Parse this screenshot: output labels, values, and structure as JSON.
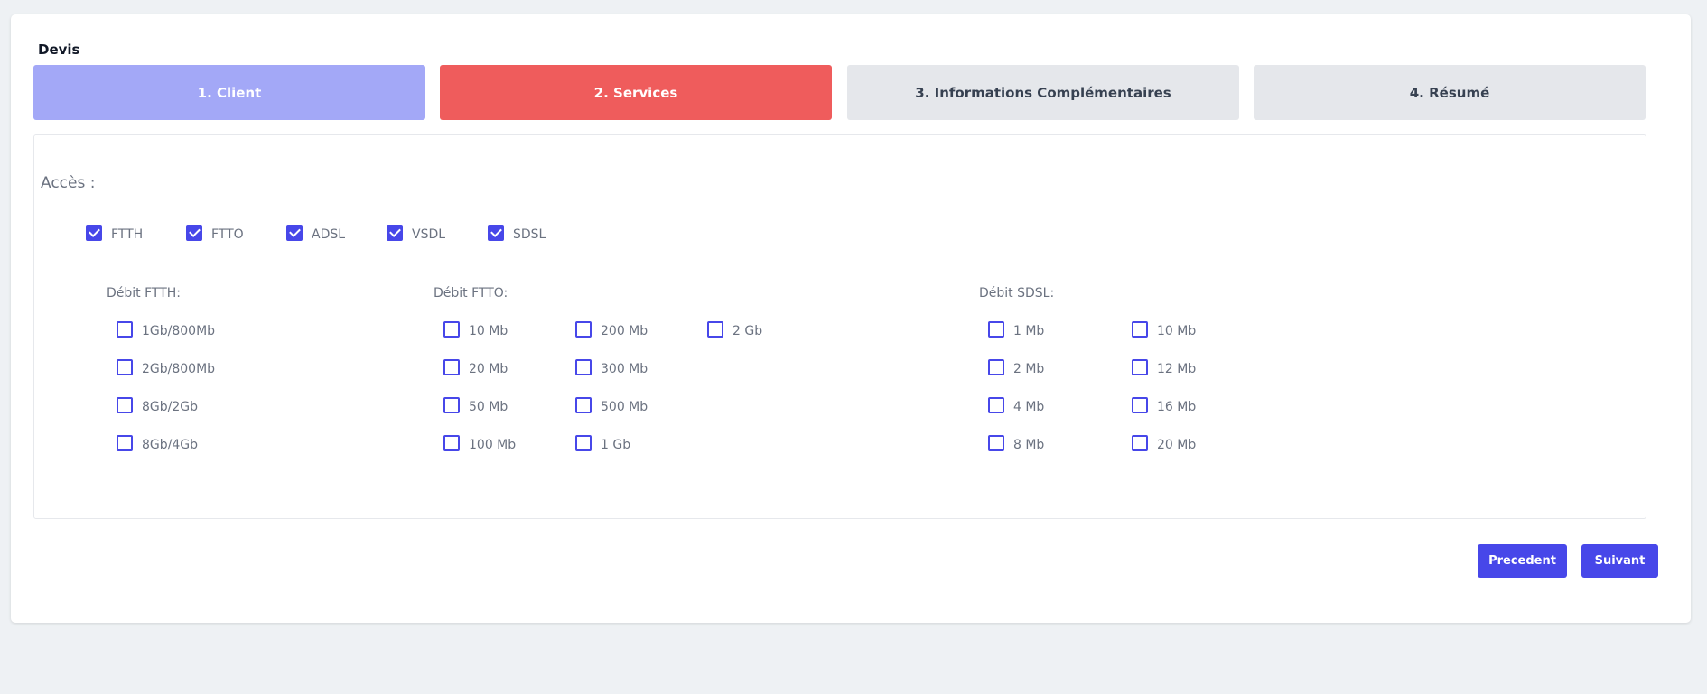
{
  "card": {
    "title": "Devis"
  },
  "steps": [
    {
      "label": "1. Client",
      "bg": "#a3a8f7",
      "fg": "#ffffff"
    },
    {
      "label": "2. Services",
      "bg": "#ef5c5c",
      "fg": "#ffffff"
    },
    {
      "label": "3. Informations Complémentaires",
      "bg": "#e5e7eb",
      "fg": "#374151"
    },
    {
      "label": "4. Résumé",
      "bg": "#e5e7eb",
      "fg": "#374151"
    }
  ],
  "acces": {
    "label": "Accès :",
    "items": [
      {
        "label": "FTTH",
        "checked": true
      },
      {
        "label": "FTTO",
        "checked": true
      },
      {
        "label": "ADSL",
        "checked": true
      },
      {
        "label": "VSDL",
        "checked": true
      },
      {
        "label": "SDSL",
        "checked": true
      }
    ]
  },
  "groups": [
    {
      "title": "Débit FTTH:",
      "columns": [
        [
          "1Gb/800Mb",
          "2Gb/800Mb",
          "8Gb/2Gb",
          "8Gb/4Gb"
        ]
      ]
    },
    {
      "title": "Débit FTTO:",
      "columns": [
        [
          "10 Mb",
          "20 Mb",
          "50 Mb",
          "100 Mb"
        ],
        [
          "200 Mb",
          "300 Mb",
          "500 Mb",
          "1 Gb"
        ],
        [
          "2 Gb"
        ]
      ]
    },
    {
      "title": "Débit SDSL:",
      "columns": [
        [
          "1 Mb",
          "2 Mb",
          "4 Mb",
          "8 Mb"
        ],
        [
          "10 Mb",
          "12 Mb",
          "16 Mb",
          "20 Mb"
        ]
      ]
    }
  ],
  "buttons": {
    "prev": "Precedent",
    "next": "Suivant"
  },
  "colors": {
    "accent": "#4747e9",
    "background": "#eef1f4"
  }
}
